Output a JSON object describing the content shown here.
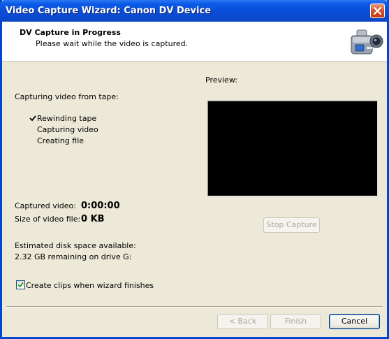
{
  "window": {
    "title": "Video Capture Wizard: Canon DV Device"
  },
  "header": {
    "title": "DV Capture in Progress",
    "subtitle": "Please wait while the video is captured."
  },
  "status": {
    "heading": "Capturing video from tape:",
    "steps": [
      {
        "label": "Rewinding tape",
        "done": true
      },
      {
        "label": "Capturing video",
        "done": false
      },
      {
        "label": "Creating file",
        "done": false
      }
    ]
  },
  "stats": {
    "captured_label": "Captured video:",
    "captured_value": "0:00:00",
    "size_label": "Size of video file:",
    "size_value": "0 KB",
    "disk_label": "Estimated disk space available:",
    "disk_value": "2.32 GB remaining on drive G:"
  },
  "preview": {
    "label": "Preview:",
    "stop_button": "Stop Capture"
  },
  "options": {
    "create_clips_label": "Create clips when wizard finishes",
    "create_clips_checked": true
  },
  "footer": {
    "back_label": "< Back",
    "finish_label": "Finish",
    "cancel_label": "Cancel"
  },
  "icons": {
    "close": "close-icon",
    "camera": "camcorder-icon",
    "check": "checkmark-icon"
  }
}
